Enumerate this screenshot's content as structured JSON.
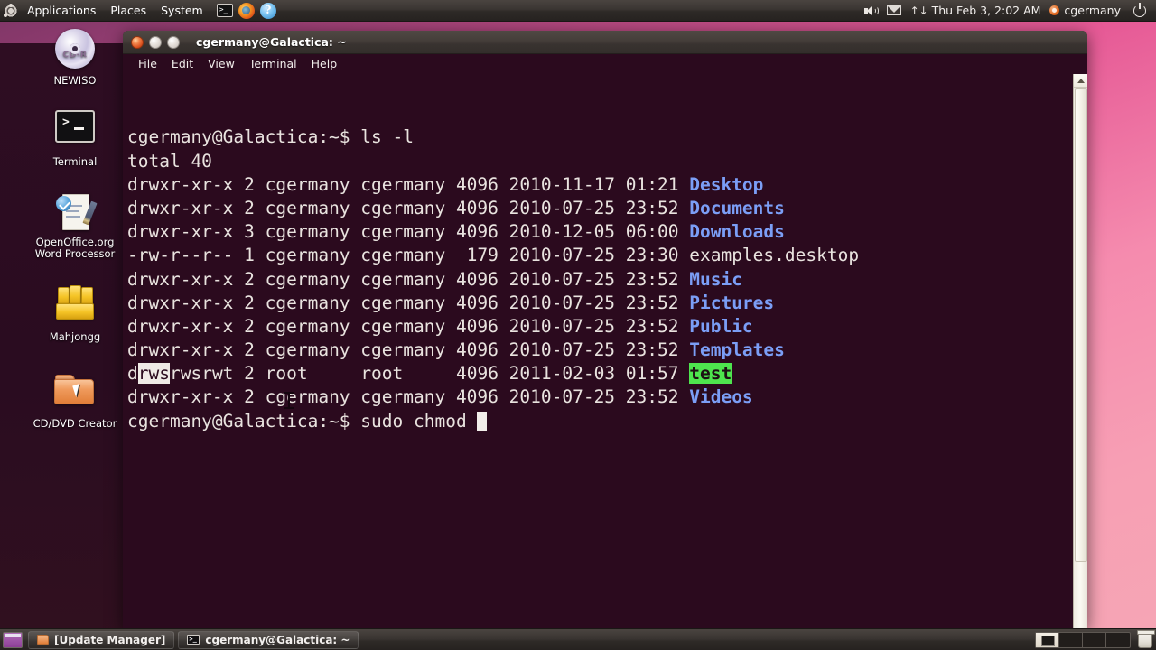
{
  "top_panel": {
    "logo": "ubuntu-logo",
    "menus": [
      "Applications",
      "Places",
      "System"
    ],
    "quick_launch": [
      {
        "name": "terminal-launcher",
        "glyph": ">_"
      },
      {
        "name": "firefox-launcher",
        "glyph": ""
      },
      {
        "name": "help-launcher",
        "glyph": "?"
      }
    ],
    "tray": {
      "volume_icon": "volume-icon",
      "mail_icon": "mail-icon",
      "network_icon": "network-icon",
      "network_glyph": "↑↓",
      "clock": "Thu Feb  3,  2:02 AM",
      "user": "cgermany",
      "power_icon": "power-icon"
    }
  },
  "desktop": {
    "icons": [
      {
        "label": "NEWISO",
        "icon": "cd-disc-icon",
        "disc_label": "CD-R"
      },
      {
        "label": "Terminal",
        "icon": "terminal-icon"
      },
      {
        "label": "OpenOffice.org\nWord Processor",
        "label_line1": "OpenOffice.org",
        "label_line2": "Word Processor",
        "icon": "openoffice-writer-icon"
      },
      {
        "label": "Mahjongg",
        "icon": "mahjongg-icon"
      },
      {
        "label": "CD/DVD Creator",
        "icon": "cd-dvd-creator-folder-icon"
      }
    ]
  },
  "terminal_window": {
    "title": "cgermany@Galactica: ~",
    "window_buttons": [
      "close",
      "minimize",
      "maximize"
    ],
    "menubar": [
      "File",
      "Edit",
      "View",
      "Terminal",
      "Help"
    ],
    "colors": {
      "background": "#2b0a1e",
      "foreground": "#e8e2de",
      "directory": "#7b9ef6",
      "sticky_other_writable_bg": "#4ee44e",
      "selection_bg": "#efeae6"
    },
    "lines": [
      {
        "type": "prompt",
        "prompt": "cgermany@Galactica:~$ ",
        "command": "ls -l"
      },
      {
        "type": "plain",
        "text": "total 40"
      },
      {
        "type": "listing",
        "perms": "drwxr-xr-x",
        "links": "2",
        "owner": "cgermany",
        "group": "cgermany",
        "size": "4096",
        "date": "2010-11-17",
        "time": "01:21",
        "name": "Desktop",
        "name_style": "dir"
      },
      {
        "type": "listing",
        "perms": "drwxr-xr-x",
        "links": "2",
        "owner": "cgermany",
        "group": "cgermany",
        "size": "4096",
        "date": "2010-07-25",
        "time": "23:52",
        "name": "Documents",
        "name_style": "dir"
      },
      {
        "type": "listing",
        "perms": "drwxr-xr-x",
        "links": "3",
        "owner": "cgermany",
        "group": "cgermany",
        "size": "4096",
        "date": "2010-12-05",
        "time": "06:00",
        "name": "Downloads",
        "name_style": "dir"
      },
      {
        "type": "listing",
        "perms": "-rw-r--r--",
        "links": "1",
        "owner": "cgermany",
        "group": "cgermany",
        "size": " 179",
        "date": "2010-07-25",
        "time": "23:30",
        "name": "examples.desktop",
        "name_style": "file"
      },
      {
        "type": "listing",
        "perms": "drwxr-xr-x",
        "links": "2",
        "owner": "cgermany",
        "group": "cgermany",
        "size": "4096",
        "date": "2010-07-25",
        "time": "23:52",
        "name": "Music",
        "name_style": "dir"
      },
      {
        "type": "listing",
        "perms": "drwxr-xr-x",
        "links": "2",
        "owner": "cgermany",
        "group": "cgermany",
        "size": "4096",
        "date": "2010-07-25",
        "time": "23:52",
        "name": "Pictures",
        "name_style": "dir"
      },
      {
        "type": "listing",
        "perms": "drwxr-xr-x",
        "links": "2",
        "owner": "cgermany",
        "group": "cgermany",
        "size": "4096",
        "date": "2010-07-25",
        "time": "23:52",
        "name": "Public",
        "name_style": "dir"
      },
      {
        "type": "listing",
        "perms": "drwxr-xr-x",
        "links": "2",
        "owner": "cgermany",
        "group": "cgermany",
        "size": "4096",
        "date": "2010-07-25",
        "time": "23:52",
        "name": "Templates",
        "name_style": "dir"
      },
      {
        "type": "listing_selected",
        "perms_pre": "d",
        "perms_selected": "rws",
        "perms_post": "rwsrwt",
        "links": "2",
        "owner": "root",
        "group": "root",
        "size": "4096",
        "date": "2011-02-03",
        "time": "01:57",
        "name": "test",
        "name_style": "sticky"
      },
      {
        "type": "listing",
        "perms": "drwxr-xr-x",
        "links": "2",
        "owner": "cgermany",
        "group": "cgermany",
        "size": "4096",
        "date": "2010-07-25",
        "time": "23:52",
        "name": "Videos",
        "name_style": "dir"
      },
      {
        "type": "prompt_active",
        "prompt": "cgermany@Galactica:~$ ",
        "command": "sudo chmod "
      }
    ],
    "raw_text": [
      "cgermany@Galactica:~$ ls -l",
      "total 40",
      "drwxr-xr-x 2 cgermany cgermany 4096 2010-11-17 01:21 Desktop",
      "drwxr-xr-x 2 cgermany cgermany 4096 2010-07-25 23:52 Documents",
      "drwxr-xr-x 3 cgermany cgermany 4096 2010-12-05 06:00 Downloads",
      "-rw-r--r-- 1 cgermany cgermany  179 2010-07-25 23:30 examples.desktop",
      "drwxr-xr-x 2 cgermany cgermany 4096 2010-07-25 23:52 Music",
      "drwxr-xr-x 2 cgermany cgermany 4096 2010-07-25 23:52 Pictures",
      "drwxr-xr-x 2 cgermany cgermany 4096 2010-07-25 23:52 Public",
      "drwxr-xr-x 2 cgermany cgermany 4096 2010-07-25 23:52 Templates",
      "drwsrwsrwt 2 root     root     4096 2011-02-03 01:57 test",
      "drwxr-xr-x 2 cgermany cgermany 4096 2010-07-25 23:52 Videos",
      "cgermany@Galactica:~$ sudo chmod "
    ],
    "scrollbar": {
      "name": "terminal-scrollbar",
      "up_arrow": "▲"
    }
  },
  "bottom_panel": {
    "show_desktop": "show-desktop-button",
    "tasks": [
      {
        "label": "[Update Manager]",
        "icon": "folder-icon"
      },
      {
        "label": "cgermany@Galactica: ~",
        "icon": "terminal-icon"
      }
    ],
    "workspaces": {
      "count": 4,
      "active_index": 0
    },
    "trash": "trash-icon"
  }
}
